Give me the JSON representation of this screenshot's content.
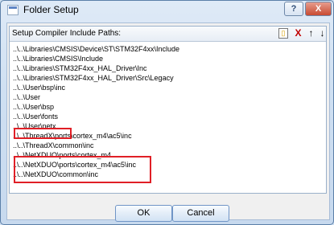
{
  "window": {
    "title": "Folder Setup",
    "help_label": "?",
    "close_label": "X"
  },
  "group": {
    "label": "Setup Compiler Include Paths:",
    "tools": {
      "new": "▯",
      "delete": "X",
      "up": "↑",
      "down": "↓"
    }
  },
  "paths": [
    "..\\..\\Libraries\\CMSIS\\Device\\ST\\STM32F4xx\\Include",
    "..\\..\\Libraries\\CMSIS\\Include",
    "..\\..\\Libraries\\STM32F4xx_HAL_Driver\\Inc",
    "..\\..\\Libraries\\STM32F4xx_HAL_Driver\\Src\\Legacy",
    "..\\..\\User\\bsp\\inc",
    "..\\..\\User",
    "..\\..\\User\\bsp",
    "..\\..\\User\\fonts",
    "..\\..\\User\\netx",
    "..\\..\\ThreadX\\ports\\cortex_m4\\ac5\\inc",
    "..\\..\\ThreadX\\common\\inc",
    "..\\..\\NetXDUO\\ports\\cortex_m4",
    "..\\..\\NetXDUO\\ports\\cortex_m4\\ac5\\inc",
    "..\\..\\NetXDUO\\common\\inc"
  ],
  "buttons": {
    "ok": "OK",
    "cancel": "Cancel"
  },
  "colors": {
    "highlight": "#e01f26",
    "delete_icon": "#c00000"
  },
  "icons": {
    "new": "new-folder-icon",
    "delete": "delete-icon",
    "up": "move-up-icon",
    "down": "move-down-icon"
  }
}
